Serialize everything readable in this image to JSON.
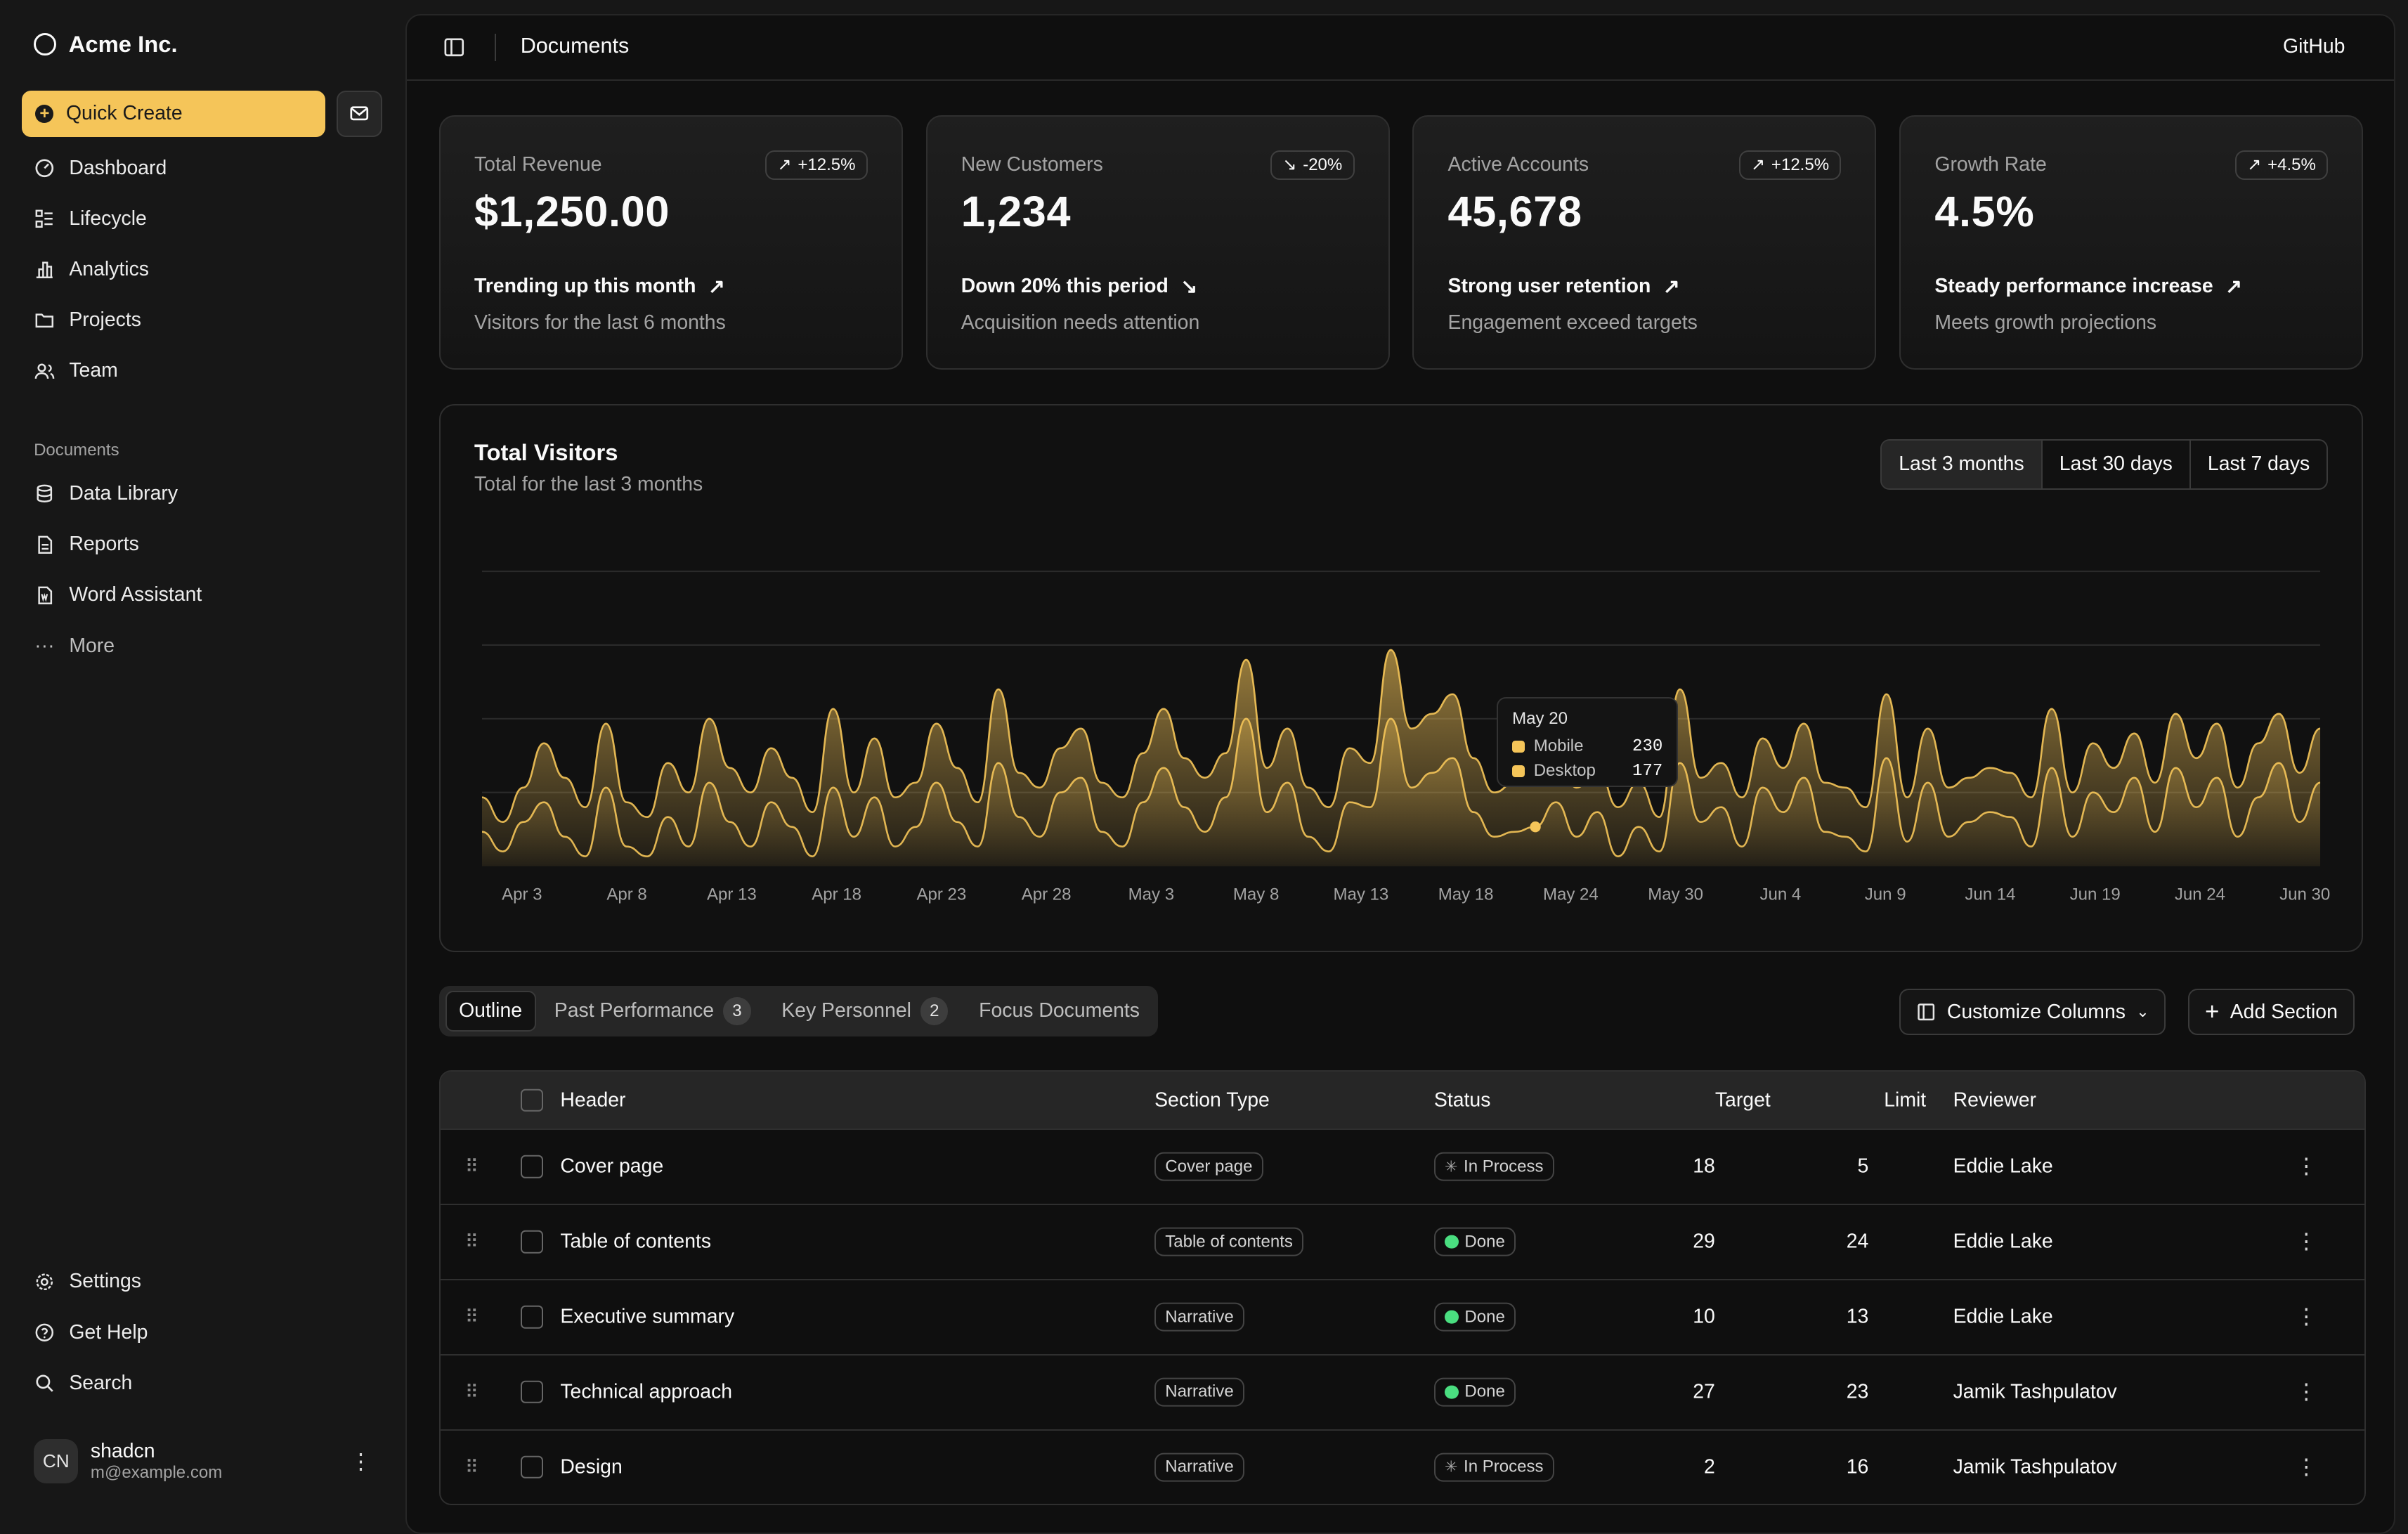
{
  "brand": {
    "name": "Acme Inc."
  },
  "sidebar": {
    "quick_create": "Quick Create",
    "main_items": [
      {
        "label": "Dashboard",
        "icon": "dashboard-icon"
      },
      {
        "label": "Lifecycle",
        "icon": "list-icon"
      },
      {
        "label": "Analytics",
        "icon": "bar-chart-icon"
      },
      {
        "label": "Projects",
        "icon": "folder-icon"
      },
      {
        "label": "Team",
        "icon": "users-icon"
      }
    ],
    "documents_label": "Documents",
    "doc_items": [
      {
        "label": "Data Library",
        "icon": "database-icon"
      },
      {
        "label": "Reports",
        "icon": "report-icon"
      },
      {
        "label": "Word Assistant",
        "icon": "file-word-icon"
      },
      {
        "label": "More",
        "icon": "dots-icon"
      }
    ],
    "footer_items": [
      {
        "label": "Settings",
        "icon": "settings-icon"
      },
      {
        "label": "Get Help",
        "icon": "help-icon"
      },
      {
        "label": "Search",
        "icon": "search-icon"
      }
    ],
    "user": {
      "initials": "CN",
      "name": "shadcn",
      "email": "m@example.com"
    }
  },
  "header": {
    "title": "Documents",
    "github": "GitHub"
  },
  "cards": [
    {
      "label": "Total Revenue",
      "badge": "+12.5%",
      "value": "$1,250.00",
      "trend": "Trending up this month",
      "sub": "Visitors for the last 6 months",
      "direction": "up"
    },
    {
      "label": "New Customers",
      "badge": "-20%",
      "value": "1,234",
      "trend": "Down 20% this period",
      "sub": "Acquisition needs attention",
      "direction": "down"
    },
    {
      "label": "Active Accounts",
      "badge": "+12.5%",
      "value": "45,678",
      "trend": "Strong user retention",
      "sub": "Engagement exceed targets",
      "direction": "up"
    },
    {
      "label": "Growth Rate",
      "badge": "+4.5%",
      "value": "4.5%",
      "trend": "Steady performance increase",
      "sub": "Meets growth projections",
      "direction": "up"
    }
  ],
  "chart": {
    "title": "Total Visitors",
    "subtitle": "Total for the last 3 months",
    "ranges": [
      "Last 3 months",
      "Last 30 days",
      "Last 7 days"
    ],
    "selected_range": "Last 3 months",
    "tooltip": {
      "date": "May 20",
      "mobile_label": "Mobile",
      "mobile_value": "230",
      "desktop_label": "Desktop",
      "desktop_value": "177"
    }
  },
  "chart_data": {
    "type": "area",
    "series_names": [
      "Mobile",
      "Desktop"
    ],
    "x_tick_labels": [
      "Apr 3",
      "Apr 8",
      "Apr 13",
      "Apr 18",
      "Apr 23",
      "Apr 28",
      "May 3",
      "May 8",
      "May 13",
      "May 18",
      "May 24",
      "May 30",
      "Jun 4",
      "Jun 9",
      "Jun 14",
      "Jun 19",
      "Jun 24",
      "Jun 30"
    ],
    "y_range": [
      0,
      600
    ],
    "grid": true,
    "mobile": [
      140,
      90,
      160,
      250,
      180,
      120,
      290,
      130,
      100,
      210,
      150,
      300,
      200,
      150,
      240,
      180,
      110,
      320,
      150,
      260,
      140,
      170,
      290,
      200,
      130,
      360,
      190,
      160,
      240,
      280,
      170,
      140,
      230,
      320,
      220,
      180,
      230,
      420,
      200,
      280,
      160,
      120,
      240,
      210,
      440,
      280,
      310,
      350,
      220,
      150,
      170,
      180,
      230,
      160,
      200,
      120,
      170,
      100,
      360,
      180,
      210,
      140,
      260,
      200,
      290,
      170,
      160,
      120,
      350,
      140,
      280,
      160,
      180,
      200,
      190,
      140,
      320,
      150,
      250,
      200,
      270,
      170,
      310,
      220,
      290,
      160,
      250,
      310,
      190,
      280
    ],
    "desktop": [
      70,
      30,
      90,
      130,
      60,
      20,
      160,
      40,
      20,
      100,
      40,
      170,
      90,
      40,
      130,
      80,
      20,
      160,
      60,
      140,
      40,
      80,
      170,
      90,
      40,
      210,
      100,
      60,
      150,
      180,
      70,
      40,
      130,
      200,
      120,
      70,
      140,
      300,
      110,
      170,
      60,
      30,
      130,
      120,
      300,
      160,
      190,
      220,
      110,
      60,
      70,
      80,
      130,
      60,
      110,
      20,
      80,
      30,
      210,
      90,
      120,
      40,
      160,
      110,
      180,
      70,
      60,
      30,
      220,
      50,
      170,
      60,
      90,
      110,
      100,
      40,
      200,
      60,
      150,
      110,
      180,
      70,
      200,
      120,
      180,
      60,
      140,
      210,
      90,
      170
    ]
  },
  "tabs": {
    "outline": "Outline",
    "past_performance": "Past Performance",
    "past_performance_count": "3",
    "key_personnel": "Key Personnel",
    "key_personnel_count": "2",
    "focus_documents": "Focus Documents",
    "customize_columns": "Customize Columns",
    "add_section": "Add Section"
  },
  "table": {
    "columns": {
      "header": "Header",
      "section_type": "Section Type",
      "status": "Status",
      "target": "Target",
      "limit": "Limit",
      "reviewer": "Reviewer"
    },
    "rows": [
      {
        "header": "Cover page",
        "section_type": "Cover page",
        "status": "In Process",
        "target": "18",
        "limit": "5",
        "reviewer": "Eddie Lake"
      },
      {
        "header": "Table of contents",
        "section_type": "Table of contents",
        "status": "Done",
        "target": "29",
        "limit": "24",
        "reviewer": "Eddie Lake"
      },
      {
        "header": "Executive summary",
        "section_type": "Narrative",
        "status": "Done",
        "target": "10",
        "limit": "13",
        "reviewer": "Eddie Lake"
      },
      {
        "header": "Technical approach",
        "section_type": "Narrative",
        "status": "Done",
        "target": "27",
        "limit": "23",
        "reviewer": "Jamik Tashpulatov"
      },
      {
        "header": "Design",
        "section_type": "Narrative",
        "status": "In Process",
        "target": "2",
        "limit": "16",
        "reviewer": "Jamik Tashpulatov"
      }
    ]
  },
  "colors": {
    "accent": "#f5c559",
    "background": "#171717",
    "panel": "#0f0f0f",
    "done": "#4ade80"
  }
}
